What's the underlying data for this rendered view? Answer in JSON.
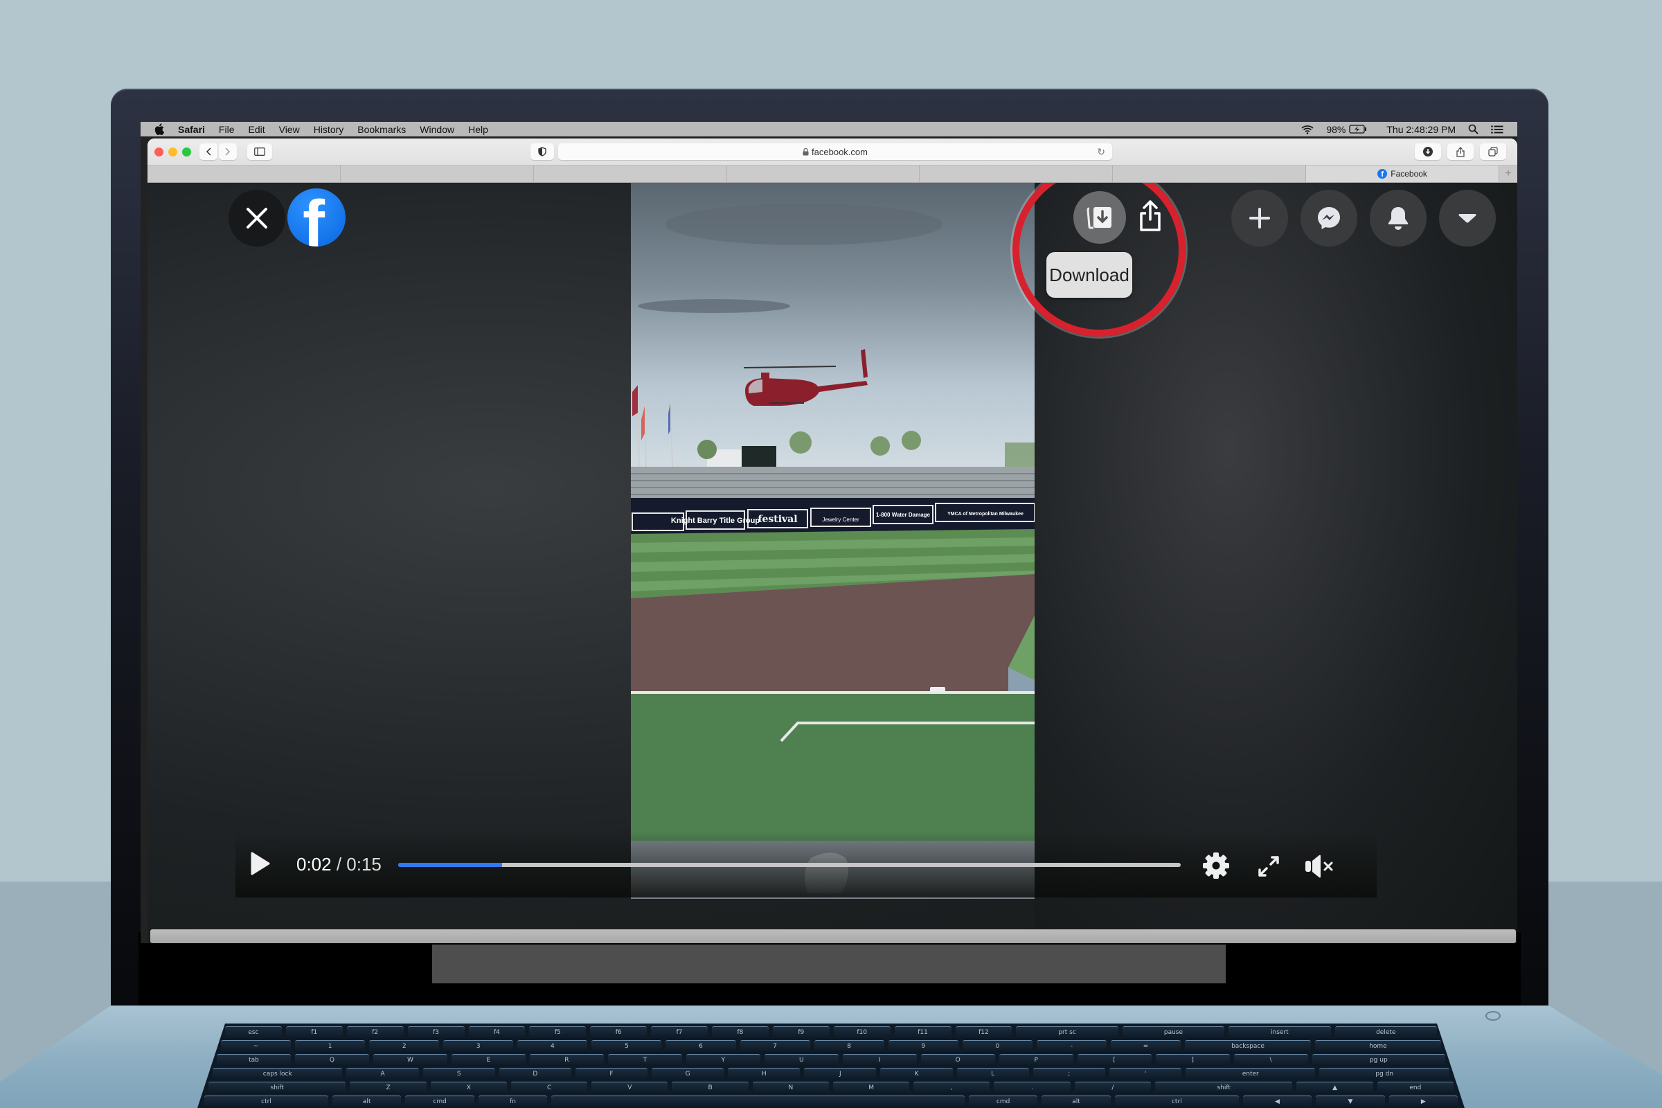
{
  "menubar": {
    "app_name": "Safari",
    "items": [
      "File",
      "Edit",
      "View",
      "History",
      "Bookmarks",
      "Window",
      "Help"
    ],
    "battery": "98%",
    "clock": "Thu 2:48:29 PM"
  },
  "browser": {
    "url": "facebook.com",
    "tabs": [
      {
        "label": ""
      },
      {
        "label": ""
      },
      {
        "label": ""
      },
      {
        "label": ""
      },
      {
        "label": ""
      },
      {
        "label": ""
      },
      {
        "label": "Facebook",
        "active": true
      }
    ]
  },
  "viewer": {
    "download_tooltip": "Download",
    "highlight_color": "#d9202d",
    "brand_color": "#1877f2",
    "video": {
      "current_time": "0:02",
      "separator": " / ",
      "duration": "0:15",
      "progress_fraction": 0.133,
      "muted": true,
      "progress_color": "#3378f0"
    },
    "banner_ads": [
      "Knight Barry Title Group",
      "festival",
      "Jewelry Center",
      "1-800 Water Damage",
      "YMCA of Metropolitan Milwaukee"
    ]
  },
  "keyboard": {
    "rows": [
      [
        "esc",
        "f1",
        "f2",
        "f3",
        "f4",
        "f5",
        "f6",
        "f7",
        "f8",
        "f9",
        "f10",
        "f11",
        "f12",
        "prt sc",
        "pause",
        "insert",
        "delete"
      ],
      [
        "~",
        "1",
        "2",
        "3",
        "4",
        "5",
        "6",
        "7",
        "8",
        "9",
        "0",
        "-",
        "=",
        "backspace",
        "home"
      ],
      [
        "tab",
        "Q",
        "W",
        "E",
        "R",
        "T",
        "Y",
        "U",
        "I",
        "O",
        "P",
        "[",
        "]",
        "\\",
        "pg up"
      ],
      [
        "caps lock",
        "A",
        "S",
        "D",
        "F",
        "G",
        "H",
        "J",
        "K",
        "L",
        ";",
        "'",
        "enter",
        "pg dn"
      ],
      [
        "shift",
        "Z",
        "X",
        "C",
        "V",
        "B",
        "N",
        "M",
        ",",
        ".",
        "/",
        "shift",
        "▲",
        "end"
      ],
      [
        "ctrl",
        "alt",
        "cmd",
        "fn",
        "",
        "cmd",
        "alt",
        "ctrl",
        "◀",
        "▼",
        "▶"
      ]
    ]
  }
}
